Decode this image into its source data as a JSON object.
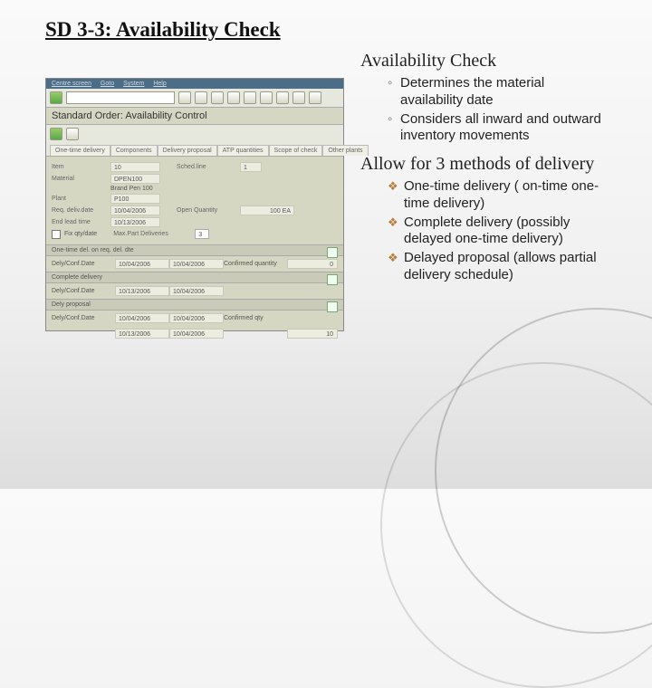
{
  "title": "SD 3-3: Availability Check",
  "sap": {
    "menu": [
      "Centre screen",
      "Goto",
      "System",
      "Help"
    ],
    "heading": "Standard Order: Availability Control",
    "tabs": [
      "One-time delivery",
      "Components",
      "Delivery proposal",
      "ATP quantities",
      "Scope of check",
      "Other plants"
    ],
    "fields": {
      "item_label": "Item",
      "item_val": "10",
      "sched_label": "Sched.line",
      "sched_val": "1",
      "material_label": "Material",
      "material_val": "DPEN100",
      "mat_desc": "Brand Pen 100",
      "plant_label": "Plant",
      "plant_val": "P100",
      "req_label": "Req. deliv.date",
      "req_val": "10/04/2006",
      "open_label": "Open Quantity",
      "open_val": "100  EA",
      "end_label": "End lead time",
      "end_val": "10/13/2006",
      "fix_label": "Fix qty/date",
      "max_label": "Max.Part Deliveries",
      "max_val": "3"
    },
    "s1_head": "One-time del. on req. del. dte",
    "s1_row": {
      "c1": "Dely/Conf.Date",
      "c2": "10/04/2006",
      "c3": "10/04/2006",
      "c4": "Confirmed quantity",
      "c5": "0"
    },
    "s2_head": "Complete delivery",
    "s2_row": {
      "c1": "Dely/Conf.Date",
      "c2": "10/13/2006",
      "c3": "10/04/2006",
      "c4": "",
      "c5": ""
    },
    "s3_head": "Dely proposal",
    "s3_row1": {
      "c1": "Dely/Conf.Date",
      "c2": "10/04/2006",
      "c3": "10/04/2006",
      "c4": "Confirmed qty",
      "c5": ""
    },
    "s3_row2": {
      "c1": "",
      "c2": "10/13/2006",
      "c3": "10/04/2006",
      "c4": "",
      "c5": "10"
    }
  },
  "subheading1": "Availability Check",
  "bullets_circ": [
    "Determines the material availability date",
    "Considers all inward and outward inventory movements"
  ],
  "subheading2": "Allow for 3 methods of delivery",
  "bullets_dia": [
    "One-time delivery ( on-time one-time delivery)",
    "Complete delivery (possibly delayed one-time delivery)",
    "Delayed proposal (allows partial delivery schedule)"
  ]
}
